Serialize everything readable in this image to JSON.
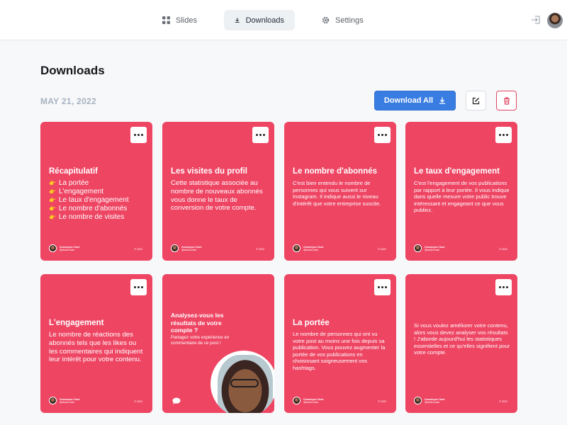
{
  "nav": {
    "tabs": [
      {
        "label": "Slides",
        "icon": "grid-icon"
      },
      {
        "label": "Downloads",
        "icon": "download-icon"
      },
      {
        "label": "Settings",
        "icon": "gear-icon"
      }
    ],
    "active_tab": "Downloads"
  },
  "header": {
    "title": "Downloads",
    "date": "MAY 21, 2022",
    "download_all_label": "Download All"
  },
  "colors": {
    "card": "#ee4563",
    "primary": "#3a7de2",
    "danger": "#e04463",
    "date": "#a7b3c2"
  },
  "cards": [
    {
      "title": "Récapitulatif",
      "items": [
        "La portée",
        "L'engagement",
        "Le taux d'engagement",
        "Le nombre d'abonnés",
        "Le nombre de visites"
      ],
      "author": "Oussenyou Cissé",
      "handle": "@studio.cisse",
      "year": "© 2022"
    },
    {
      "title": "Les visites du profil",
      "body": "Cette statistique associée au nombre de nouveaux abonnés vous donne le taux de conversion de votre compte.",
      "author": "Oussenyou Cissé",
      "handle": "@studio.cisse",
      "year": "© 2022"
    },
    {
      "title": "Le nombre d'abonnés",
      "body": "C'est bien entendu le nombre de personnes qui vous suivent sur Instagram. Il indique aussi le niveau d'intérêt que votre entreprise suscite.",
      "author": "Oussenyou Cissé",
      "handle": "@studio.cisse",
      "year": "© 2022"
    },
    {
      "title": "Le taux d'engagement",
      "body": "C'est l'engagement de vos publications par rapport à leur portée. Il vous indique dans quelle mesure votre public trouve intéressant et engageant ce que vous publiez.",
      "author": "Oussenyou Cissé",
      "handle": "@studio.cisse",
      "year": "© 2022"
    },
    {
      "title": "L'engagement",
      "body": "Le nombre de réactions des abonnés tels que les likes ou les commentaires qui indiquent leur intérêt pour votre contenu.",
      "author": "Oussenyou Cissé",
      "handle": "@studio.cisse",
      "year": "© 2022"
    },
    {
      "title": "Analysez-vous les résultats de votre compte ?",
      "body": "Partagez votre expérience en commentaire de ce post !"
    },
    {
      "title": "La portée",
      "body": "Le nombre de personnes qui ont vu votre post au moins une fois depuis sa publication. Vous pouvez augmenter la portée de vos publications en choisissant soigneusement vos hashtags.",
      "author": "Oussenyou Cissé",
      "handle": "@studio.cisse",
      "year": "© 2022"
    },
    {
      "body": "Si vous voulez améliorer votre contenu, alors vous devez analyser vos résultats ! J'aborde aujourd'hui les statistiques essentielles et ce qu'elles signifient pour votre compte.",
      "author": "Oussenyou Cissé",
      "handle": "@studio.cisse",
      "year": "© 2022"
    }
  ]
}
